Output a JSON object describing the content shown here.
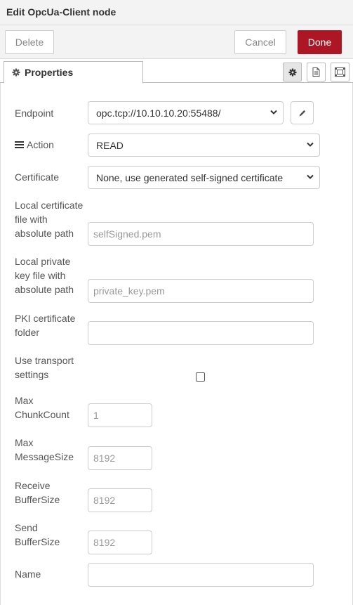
{
  "dialog": {
    "title": "Edit OpcUa-Client node"
  },
  "toolbar": {
    "delete_label": "Delete",
    "cancel_label": "Cancel",
    "done_label": "Done"
  },
  "tabs": {
    "properties_label": "Properties",
    "icons": [
      "gear-icon",
      "document-icon",
      "layout-icon"
    ]
  },
  "form": {
    "endpoint": {
      "label": "Endpoint",
      "value": "opc.tcp://10.10.10.20:55488/"
    },
    "action": {
      "label": "Action",
      "value": "READ"
    },
    "certificate": {
      "label": "Certificate",
      "value": "None, use generated self-signed certificate"
    },
    "local_cert": {
      "label_l1": "Local certificate",
      "label_l2": "file with",
      "label_l3": "absolute path",
      "placeholder": "selfSigned.pem"
    },
    "local_key": {
      "label_l1": "Local private",
      "label_l2": "key file with",
      "label_l3": "absolute path",
      "placeholder": "private_key.pem"
    },
    "pki_folder": {
      "label_l1": "PKI certificate",
      "label_l2": "folder",
      "value": ""
    },
    "transport": {
      "label_l1": "Use transport",
      "label_l2": "settings",
      "checked": false
    },
    "max_chunk": {
      "label_l1": "Max",
      "label_l2": "ChunkCount",
      "placeholder": "1"
    },
    "max_message": {
      "label_l1": "Max",
      "label_l2": "MessageSize",
      "placeholder": "8192"
    },
    "receive_buffer": {
      "label_l1": "Receive",
      "label_l2": "BufferSize",
      "placeholder": "8192"
    },
    "send_buffer": {
      "label_l1": "Send",
      "label_l2": "BufferSize",
      "placeholder": "8192"
    },
    "name": {
      "label": "Name",
      "value": ""
    }
  },
  "colors": {
    "primary": "#ad1625",
    "header_bg": "#f3f3f3",
    "border": "#cccccc"
  }
}
